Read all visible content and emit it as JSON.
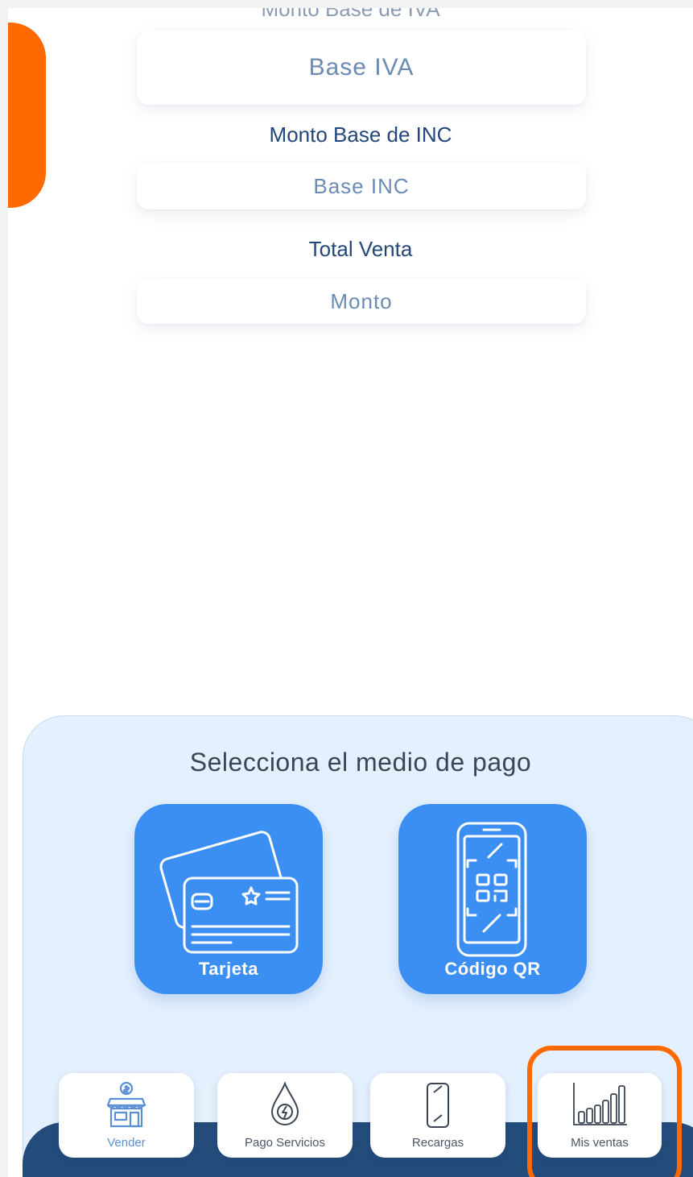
{
  "form": {
    "cut_label": "Monto Base de IVA",
    "iva_placeholder": "Base IVA",
    "inc_label": "Monto Base de INC",
    "inc_placeholder": "Base INC",
    "total_label": "Total Venta",
    "total_placeholder": "Monto"
  },
  "payment": {
    "title": "Selecciona el medio de pago",
    "card_label": "Tarjeta",
    "qr_label": "Código QR"
  },
  "nav": {
    "vender": "Vender",
    "pago_servicios": "Pago Servicios",
    "recargas": "Recargas",
    "mis_ventas": "Mis ventas"
  },
  "colors": {
    "accent_orange": "#ff6a00",
    "primary_blue": "#3b8ff3",
    "navy": "#244c7a",
    "panel_bg": "#e4f0fd"
  },
  "icons": {
    "card": "credit-cards-icon",
    "qr": "qr-phone-icon",
    "vender": "store-icon",
    "pago_servicios": "energy-drop-icon",
    "recargas": "phone-icon",
    "mis_ventas": "bar-chart-icon"
  }
}
